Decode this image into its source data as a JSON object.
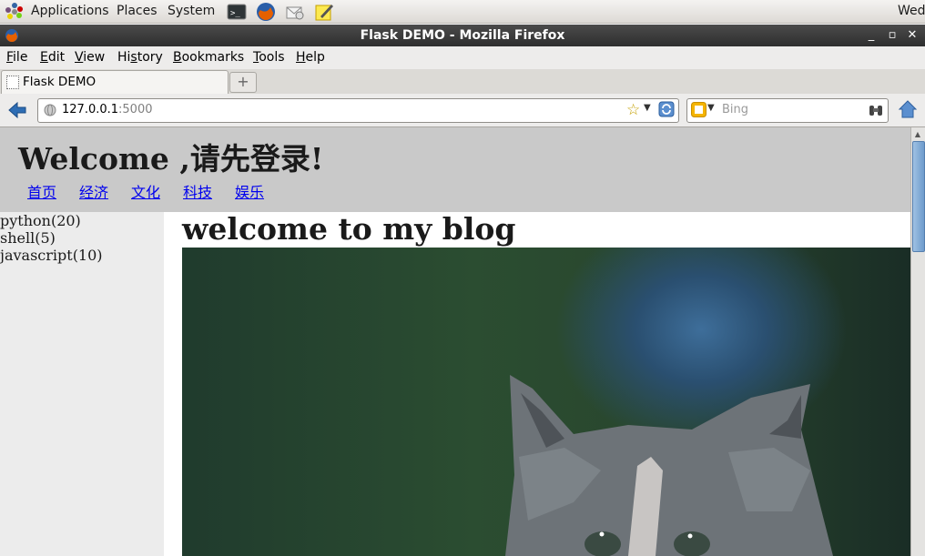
{
  "panel": {
    "menus": [
      "Applications",
      "Places",
      "System"
    ],
    "clock": "Wed"
  },
  "window": {
    "title": "Flask DEMO - Mozilla Firefox",
    "controls": [
      "minimize-icon",
      "maximize-icon",
      "close-icon"
    ]
  },
  "menubar": {
    "items": [
      {
        "label": "File",
        "mnemonic": "F"
      },
      {
        "label": "Edit",
        "mnemonic": "E"
      },
      {
        "label": "View",
        "mnemonic": "V"
      },
      {
        "label": "History",
        "mnemonic": "s"
      },
      {
        "label": "Bookmarks",
        "mnemonic": "B"
      },
      {
        "label": "Tools",
        "mnemonic": "T"
      },
      {
        "label": "Help",
        "mnemonic": "H"
      }
    ]
  },
  "tabs": [
    {
      "label": "Flask DEMO",
      "active": true
    }
  ],
  "navbar": {
    "url_host": "127.0.0.1",
    "url_port": ":5000",
    "search_placeholder": "Bing"
  },
  "page": {
    "welcome": "Welcome ,请先登录!",
    "nav_links": [
      "首页",
      "经济",
      "文化",
      "科技",
      "娱乐"
    ],
    "categories": [
      "python(20)",
      "shell(5)",
      "javascript(10)"
    ],
    "blog_title": "welcome to my blog",
    "image": "cat-photo"
  },
  "colors": {
    "link": "#0000ee",
    "header_bg": "#c9c9c9",
    "sidebar_bg": "#ececec",
    "titlebar": "#3a3a3a"
  }
}
